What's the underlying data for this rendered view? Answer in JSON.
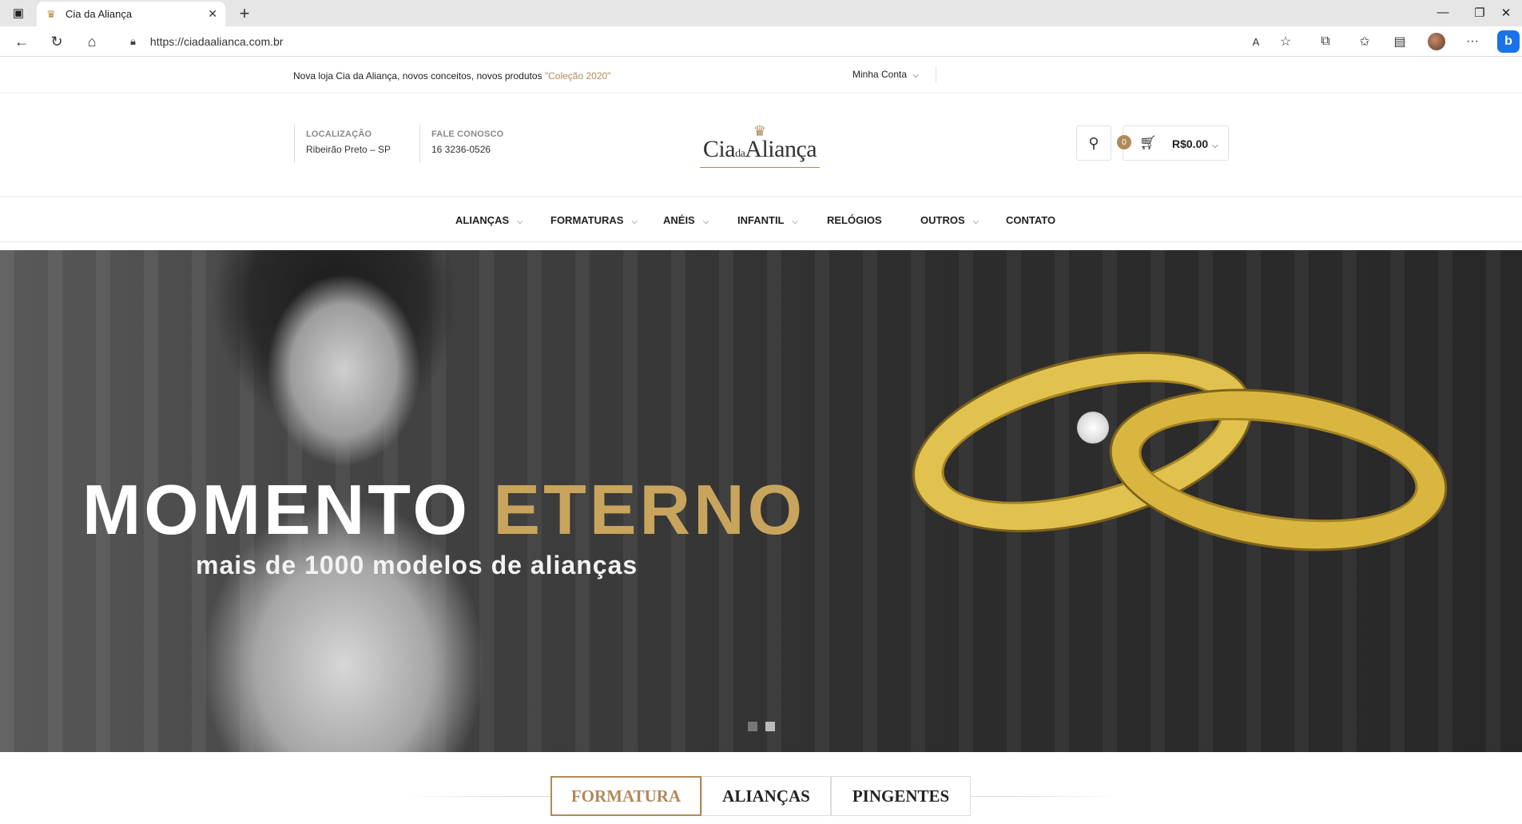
{
  "browser": {
    "tab_title": "Cia da Aliança",
    "url": "https://ciadaalianca.com.br",
    "new_tab_label": "+",
    "close_tab_label": "✕"
  },
  "topbar": {
    "promo_text": "Nova loja Cia da Aliança, novos conceitos, novos produtos ",
    "promo_highlight": "\"Coleção 2020\"",
    "account_label": "Minha Conta"
  },
  "header": {
    "location_label": "LOCALIZAÇÃO",
    "location_value": "Ribeirão Preto – SP",
    "contact_label": "FALE CONOSCO",
    "contact_value": "16 3236-0526",
    "logo_text_left": "Cia",
    "logo_text_mid": "da",
    "logo_text_right": "Aliança",
    "cart_count": "0",
    "cart_total": "R$0.00"
  },
  "menu": {
    "items": [
      {
        "label": "ALIANÇAS",
        "has_dropdown": true
      },
      {
        "label": "FORMATURAS",
        "has_dropdown": true
      },
      {
        "label": "ANÉIS",
        "has_dropdown": true
      },
      {
        "label": "INFANTIL",
        "has_dropdown": true
      },
      {
        "label": "RELÓGIOS",
        "has_dropdown": false
      },
      {
        "label": "OUTROS",
        "has_dropdown": true
      },
      {
        "label": "CONTATO",
        "has_dropdown": false
      }
    ]
  },
  "hero": {
    "title_word1": "MOMENTO",
    "title_word2": "ETERNO",
    "subtitle": "mais de 1000 modelos de alianças",
    "slide_count": 2,
    "active_slide": 2
  },
  "categories": {
    "tabs": [
      {
        "label": "FORMATURA",
        "active": true
      },
      {
        "label": "ALIANÇAS",
        "active": false
      },
      {
        "label": "PINGENTES",
        "active": false
      }
    ]
  },
  "colors": {
    "accent_gold": "#b08a5a",
    "hero_gold": "#c9a45c"
  }
}
